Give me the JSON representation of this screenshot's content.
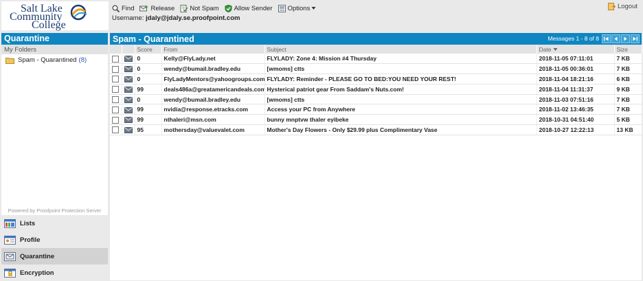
{
  "logo": {
    "line1": "Salt Lake",
    "line2": "Community",
    "line3": "College"
  },
  "toolbar": {
    "find": "Find",
    "release": "Release",
    "not_spam": "Not Spam",
    "allow_sender": "Allow Sender",
    "options": "Options"
  },
  "user": {
    "label": "Username:",
    "value": "jdaly@jdaly.se.proofpoint.com"
  },
  "logout": "Logout",
  "sidebar": {
    "title": "Quarantine",
    "my_folders": "My Folders",
    "folder": {
      "label": "Spam - Quarantined",
      "count": "(8)"
    },
    "powered_by": "Powered by Proofpoint Protection Server",
    "nav": [
      {
        "label": "Lists"
      },
      {
        "label": "Profile"
      },
      {
        "label": "Quarantine"
      },
      {
        "label": "Encryption"
      }
    ]
  },
  "main": {
    "title": "Spam - Quarantined",
    "message_count": "Messages 1 - 8 of 8",
    "columns": {
      "score": "Score",
      "from": "From",
      "subject": "Subject",
      "date": "Date",
      "size": "Size"
    },
    "rows": [
      {
        "score": "0",
        "from": "Kelly@FlyLady.net",
        "subject": "FLYLADY: Zone 4: Mission #4 Thursday",
        "date": "2018-11-05 07:11:01",
        "size": "7 KB"
      },
      {
        "score": "0",
        "from": "wendy@bumail.bradley.edu",
        "subject": "[wmoms] ctts",
        "date": "2018-11-05 00:36:01",
        "size": "7 KB"
      },
      {
        "score": "0",
        "from": "FlyLadyMentors@yahoogroups.com",
        "subject": "FLYLADY: Reminder - PLEASE GO TO BED:YOU NEED YOUR REST!",
        "date": "2018-11-04 18:21:16",
        "size": "6 KB"
      },
      {
        "score": "99",
        "from": "deals486a@greatamericandeals.com",
        "subject": "Hysterical patriot gear From Saddam's Nuts.com!",
        "date": "2018-11-04 11:31:37",
        "size": "9 KB"
      },
      {
        "score": "0",
        "from": "wendy@bumail.bradley.edu",
        "subject": "[wmoms] ctts",
        "date": "2018-11-03 07:51:16",
        "size": "7 KB"
      },
      {
        "score": "99",
        "from": "nvidia@response.etracks.com",
        "subject": "Access your PC from Anywhere",
        "date": "2018-11-02 13:46:35",
        "size": "7 KB"
      },
      {
        "score": "99",
        "from": "nthaleri@msn.com",
        "subject": "bunny mnptvw thaler eyibeke",
        "date": "2018-10-31 04:51:40",
        "size": "5 KB"
      },
      {
        "score": "95",
        "from": "mothersday@valuevalet.com",
        "subject": "Mother's Day Flowers - Only $29.99 plus Complimentary Vase",
        "date": "2018-10-27 12:22:13",
        "size": "13 KB"
      }
    ]
  },
  "colors": {
    "header_blue": "#0f86c1",
    "logo_navy": "#1c3b70",
    "count_link": "#2b57b3"
  }
}
